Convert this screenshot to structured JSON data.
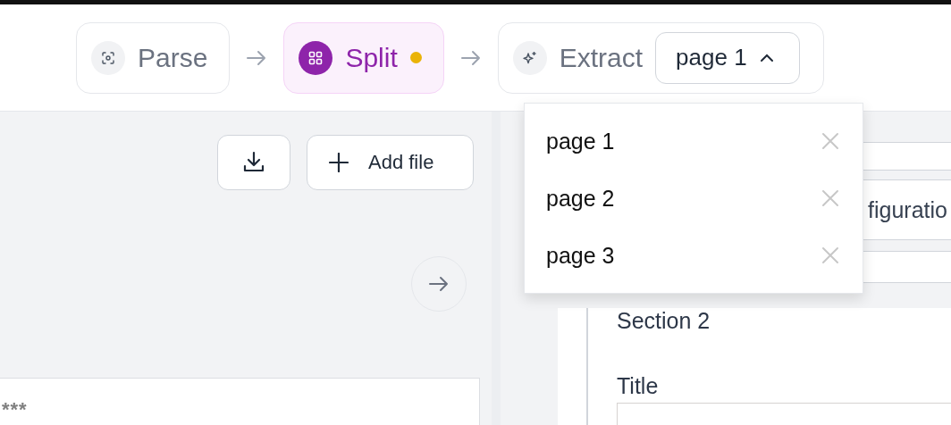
{
  "pipeline": {
    "steps": [
      {
        "label": "Parse",
        "selected": false
      },
      {
        "label": "Split",
        "selected": true,
        "color": "#eab308"
      },
      {
        "label": "Extract",
        "selected": false,
        "page_select": {
          "value": "page 1",
          "expanded": true
        }
      }
    ]
  },
  "page_menu": {
    "items": [
      {
        "label": "page 1"
      },
      {
        "label": "page 2"
      },
      {
        "label": "page 3"
      }
    ]
  },
  "left_panel": {
    "add_file_button": "Add file",
    "preview_text": "***"
  },
  "right_panel": {
    "configuration_tab": "figuratio",
    "section": {
      "title": "Section 2",
      "field_label": "Title"
    }
  }
}
